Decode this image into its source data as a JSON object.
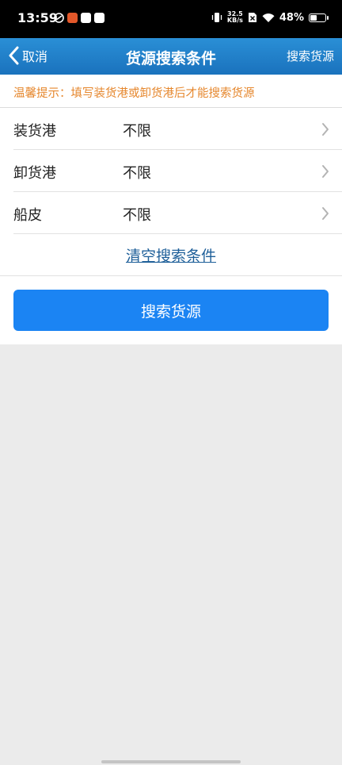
{
  "status_bar": {
    "time": "13:59",
    "net_speed_value": "32.5",
    "net_speed_unit": "KB/s",
    "battery_text": "48%",
    "battery_level": 0.48
  },
  "nav": {
    "back_label": "取消",
    "title": "货源搜索条件",
    "action_label": "搜索货源",
    "color": "#1a7bc8"
  },
  "tip": {
    "text": "温馨提示：填写装货港或卸货港后才能搜索货源",
    "color": "#e6882f"
  },
  "form": {
    "rows": [
      {
        "label": "装货港",
        "value": "不限"
      },
      {
        "label": "卸货港",
        "value": "不限"
      },
      {
        "label": "船皮",
        "value": "不限"
      }
    ],
    "clear_label": "清空搜索条件",
    "search_button_label": "搜索货源",
    "button_color": "#1b84f3"
  }
}
